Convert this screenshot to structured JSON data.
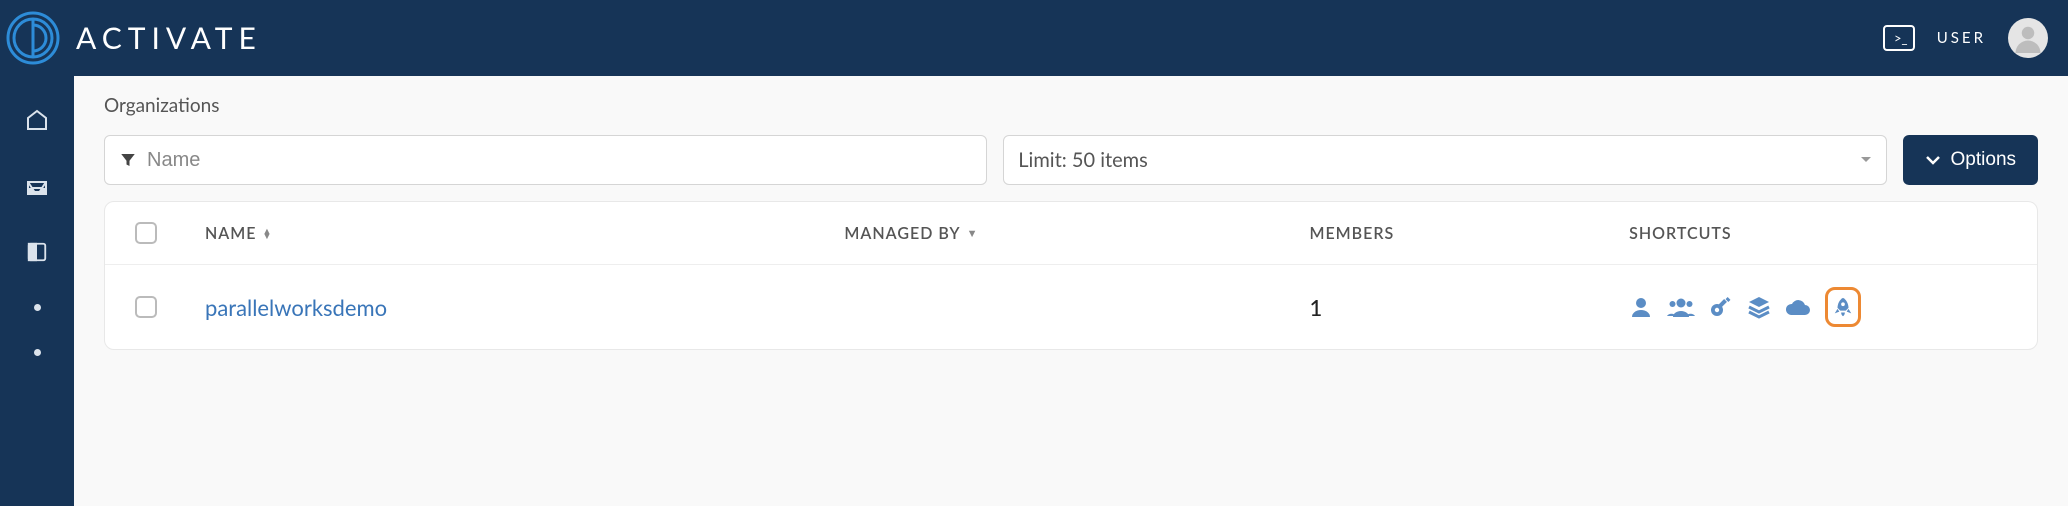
{
  "brand": {
    "name": "ACTIVATE"
  },
  "topbar": {
    "user_label": "USER"
  },
  "breadcrumb": "Organizations",
  "filters": {
    "name_placeholder": "Name",
    "limit_label": "Limit: 50 items",
    "options_label": "Options"
  },
  "columns": {
    "name": "NAME",
    "managed_by": "MANAGED BY",
    "members": "MEMBERS",
    "shortcuts": "SHORTCUTS"
  },
  "rows": [
    {
      "name": "parallelworksdemo",
      "managed_by": "",
      "members": "1"
    }
  ],
  "colors": {
    "topbar_bg": "#163457",
    "link": "#3975b8",
    "shortcut_icon": "#5b8dc5",
    "highlight": "#ed8933"
  }
}
